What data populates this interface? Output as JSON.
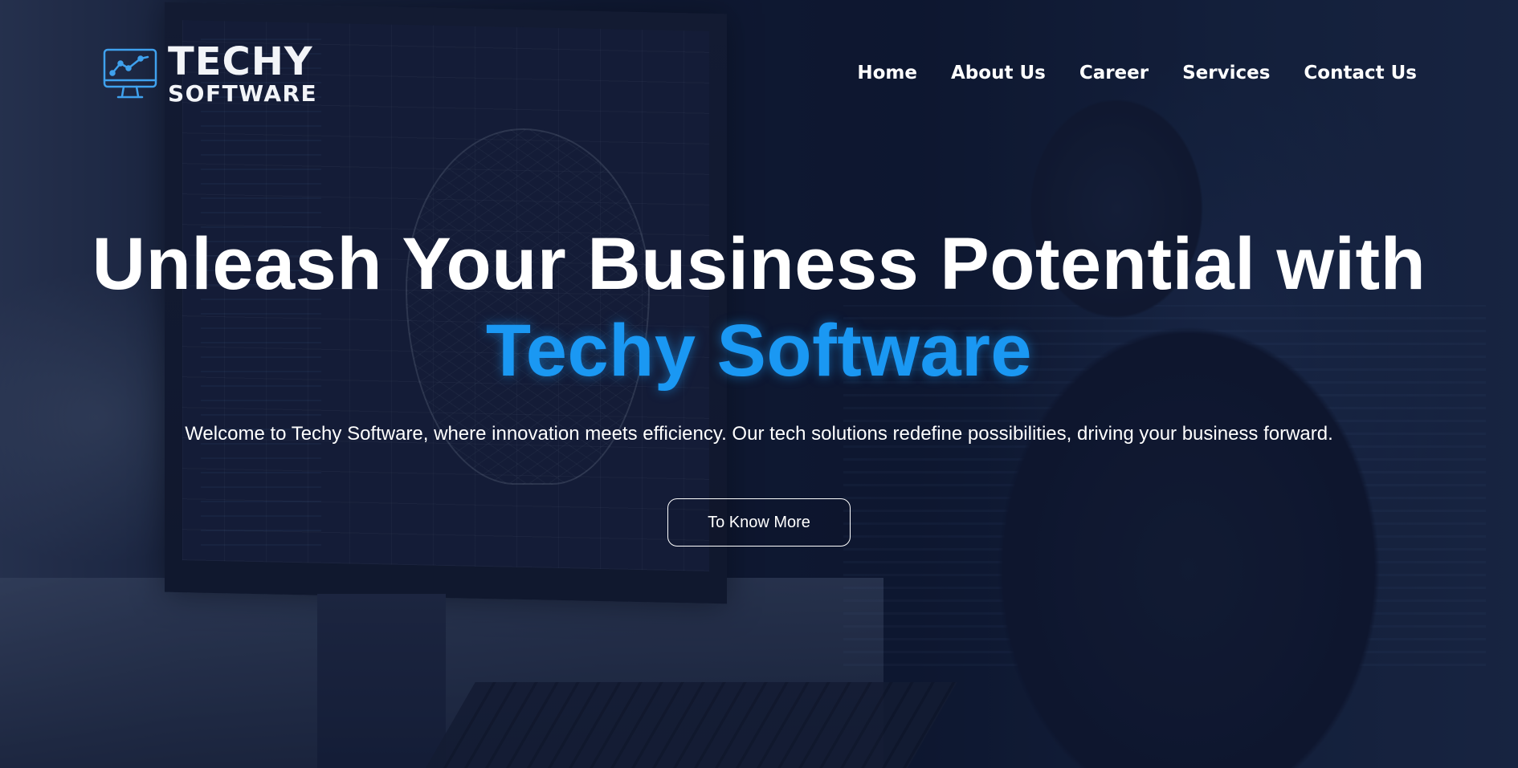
{
  "brand": {
    "name_line1": "TECHY",
    "name_line2": "SOFTWARE",
    "icon": "monitor-chart-icon"
  },
  "nav": {
    "items": [
      {
        "label": "Home"
      },
      {
        "label": "About Us"
      },
      {
        "label": "Career"
      },
      {
        "label": "Services"
      },
      {
        "label": "Contact Us"
      }
    ]
  },
  "hero": {
    "headline_line1": "Unleash Your Business Potential with",
    "headline_accent": "Techy Software",
    "subtitle": "Welcome to Techy Software, where innovation meets efficiency. Our tech solutions redefine possibilities, driving your business forward.",
    "cta_label": "To Know More"
  },
  "colors": {
    "accent": "#1a98f3",
    "text": "#ffffff",
    "overlay": "#0f1a33"
  }
}
